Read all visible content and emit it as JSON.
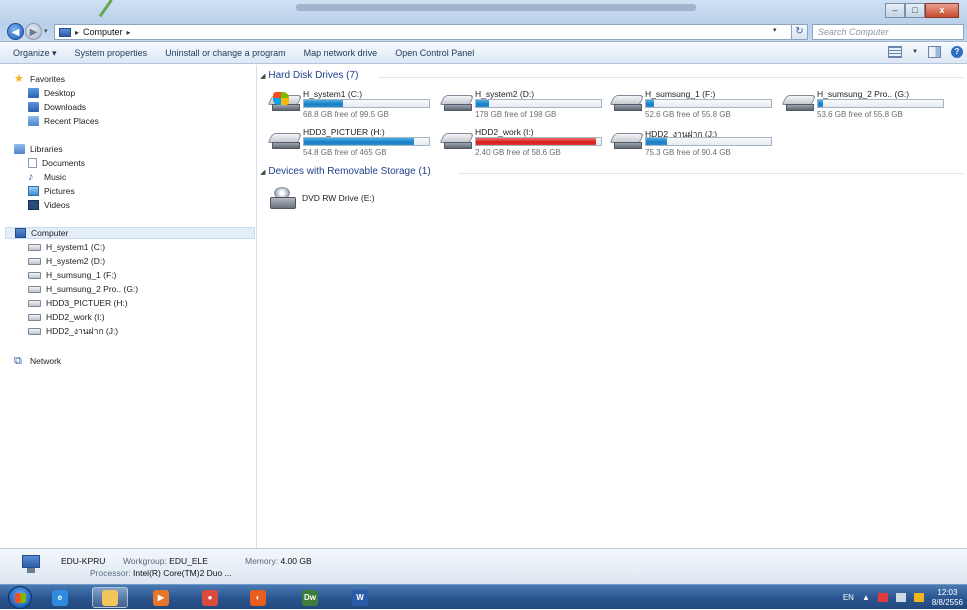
{
  "window": {
    "address": {
      "location": "Computer"
    },
    "search": {
      "placeholder": "Search Computer"
    }
  },
  "toolbar": {
    "items": [
      "Organize ▾",
      "System properties",
      "Uninstall or change a program",
      "Map network drive",
      "Open Control Panel"
    ]
  },
  "navpane": {
    "favorites": {
      "label": "Favorites",
      "items": [
        "Desktop",
        "Downloads",
        "Recent Places"
      ]
    },
    "libraries": {
      "label": "Libraries",
      "items": [
        "Documents",
        "Music",
        "Pictures",
        "Videos"
      ]
    },
    "computer": {
      "label": "Computer",
      "items": [
        "H_system1 (C:)",
        "H_system2 (D:)",
        "H_sumsung_1 (F:)",
        "H_sumsung_2 Pro.. (G:)",
        "HDD3_PICTUER (H:)",
        "HDD2_work (I:)",
        "HDD2_งานฝาก (J:)"
      ]
    },
    "network": {
      "label": "Network"
    }
  },
  "content": {
    "hard_disk_header": "Hard Disk Drives (7)",
    "removable_header": "Devices with Removable Storage (1)",
    "drives": [
      {
        "name": "H_system1 (C:)",
        "free": "68.8 GB free of 99.5 GB",
        "used_fraction": 0.31,
        "system": true,
        "full": false
      },
      {
        "name": "H_system2 (D:)",
        "free": "178 GB free of 198 GB",
        "used_fraction": 0.1,
        "system": false,
        "full": false
      },
      {
        "name": "H_sumsung_1 (F:)",
        "free": "52.6 GB free of 55.8 GB",
        "used_fraction": 0.06,
        "system": false,
        "full": false
      },
      {
        "name": "H_sumsung_2 Pro.. (G:)",
        "free": "53.6 GB free of 55.8 GB",
        "used_fraction": 0.04,
        "system": false,
        "full": false
      },
      {
        "name": "HDD3_PICTUER (H:)",
        "free": "54.8 GB free of 465 GB",
        "used_fraction": 0.88,
        "system": false,
        "full": false
      },
      {
        "name": "HDD2_work (I:)",
        "free": "2.40 GB free of 58.6 GB",
        "used_fraction": 0.96,
        "system": false,
        "full": true
      },
      {
        "name": "HDD2_งานฝาก (J:)",
        "free": "75.3 GB free of 90.4 GB",
        "used_fraction": 0.17,
        "system": false,
        "full": false
      }
    ],
    "dvd": {
      "name": "DVD RW Drive (E:)"
    }
  },
  "details": {
    "computer_name": "EDU-KPRU",
    "workgroup_label": "Workgroup:",
    "workgroup": "EDU_ELE",
    "memory_label": "Memory:",
    "memory": "4.00 GB",
    "processor_label": "Processor:",
    "processor": "Intel(R) Core(TM)2 Duo ..."
  },
  "taskbar": {
    "apps": [
      {
        "name": "ie",
        "glyph": "e",
        "color": "#2f8be0"
      },
      {
        "name": "explorer",
        "glyph": "",
        "color": "#f2c65a"
      },
      {
        "name": "media-player",
        "glyph": "▶",
        "color": "#e8762b"
      },
      {
        "name": "chrome",
        "glyph": "●",
        "color": "#d94b3c"
      },
      {
        "name": "firefox",
        "glyph": "◐",
        "color": "#e85e1f"
      },
      {
        "name": "dreamweaver",
        "glyph": "Dw",
        "color": "#3e7d3a"
      },
      {
        "name": "word",
        "glyph": "W",
        "color": "#2b5ba8"
      }
    ],
    "lang": "EN",
    "time": "12:03",
    "date": "8/8/2556"
  }
}
